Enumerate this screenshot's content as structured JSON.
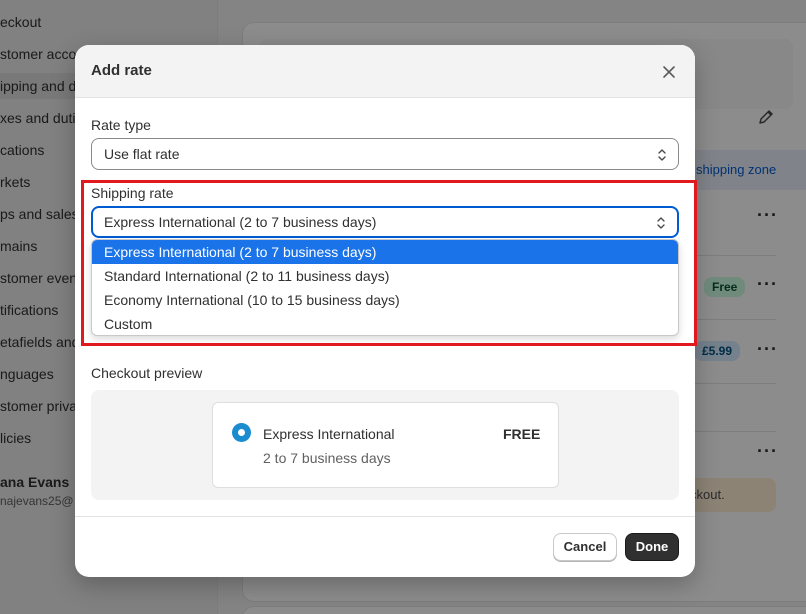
{
  "sidebar": {
    "items": [
      {
        "label": "eckout"
      },
      {
        "label": "stomer acco"
      },
      {
        "label": "ipping and d"
      },
      {
        "label": "xes and dutie"
      },
      {
        "label": "cations"
      },
      {
        "label": "rkets"
      },
      {
        "label": "ps and sales"
      },
      {
        "label": "mains"
      },
      {
        "label": "stomer even"
      },
      {
        "label": "tifications"
      },
      {
        "label": "etafields and"
      },
      {
        "label": "nguages"
      },
      {
        "label": "stomer priva"
      },
      {
        "label": "licies"
      }
    ],
    "user_name": "ana Evans",
    "user_email": "najevans25@"
  },
  "background": {
    "zone_link": "shipping zone",
    "badge_free": "Free",
    "badge_price": "£5.99",
    "banner_text": "ckout."
  },
  "modal": {
    "title": "Add rate",
    "rate_type_label": "Rate type",
    "rate_type_value": "Use flat rate",
    "shipping_rate_label": "Shipping rate",
    "shipping_rate_value": "Express International (2 to 7 business days)",
    "options": [
      {
        "label": "Express International (2 to 7 business days)"
      },
      {
        "label": "Standard International (2 to 11 business days)"
      },
      {
        "label": "Economy International (10 to 15 business days)"
      },
      {
        "label": "Custom"
      }
    ],
    "preview_label": "Checkout preview",
    "preview": {
      "name": "Express International",
      "price": "FREE",
      "days": "2 to 7 business days"
    },
    "cancel_label": "Cancel",
    "done_label": "Done"
  },
  "colors": {
    "accent": "#005bd3",
    "selected_option": "#1a73e8",
    "highlight_border": "#e1191e",
    "primary_button": "#303030"
  }
}
